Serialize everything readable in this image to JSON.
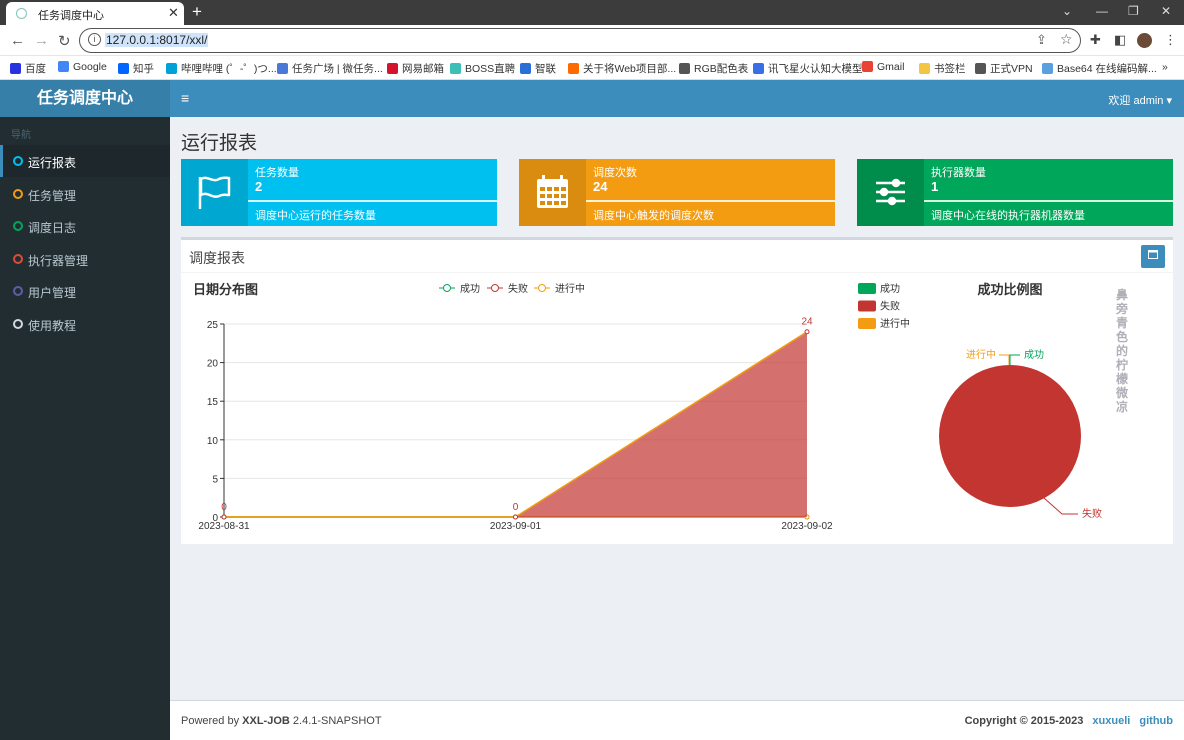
{
  "browser": {
    "tab_title": "任务调度中心",
    "tab_close": "✕",
    "new_tab": "+",
    "url": "127.0.0.1:8017/xxl/",
    "bookmarks": [
      {
        "label": "百度",
        "color": "#2932e1"
      },
      {
        "label": "Google",
        "color": "#4285f4"
      },
      {
        "label": "知乎",
        "color": "#0066ff"
      },
      {
        "label": "哔哩哔哩 (゜-゜)つ...",
        "color": "#00a1d6"
      },
      {
        "label": "任务广场 | 微任务...",
        "color": "#4a78d6"
      },
      {
        "label": "网易邮箱",
        "color": "#d4142a"
      },
      {
        "label": "BOSS直聘",
        "color": "#3bbfb6"
      },
      {
        "label": "智联",
        "color": "#2a6fd6"
      },
      {
        "label": "关于将Web项目部...",
        "color": "#ff6a00"
      },
      {
        "label": "RGB配色表",
        "color": "#555555"
      },
      {
        "label": "讯飞星火认知大模型",
        "color": "#3a6ee8"
      },
      {
        "label": "Gmail",
        "color": "#ea4335"
      },
      {
        "label": "书签栏",
        "color": "#f4c542"
      },
      {
        "label": "正式VPN",
        "color": "#555555"
      },
      {
        "label": "Base64 在线编码解...",
        "color": "#5aa0e0"
      }
    ],
    "more_bookmarks": "»"
  },
  "app": {
    "logo": "任务调度中心",
    "menu_toggle": "≡",
    "welcome": "欢迎 admin ▾"
  },
  "sidebar": {
    "header": "导航",
    "items": [
      {
        "label": "运行报表",
        "color": "#00c0ef",
        "active": true
      },
      {
        "label": "任务管理",
        "color": "#f39c12",
        "active": false
      },
      {
        "label": "调度日志",
        "color": "#00a65a",
        "active": false
      },
      {
        "label": "执行器管理",
        "color": "#dd4b39",
        "active": false
      },
      {
        "label": "用户管理",
        "color": "#605ca8",
        "active": false
      },
      {
        "label": "使用教程",
        "color": "#d2d6de",
        "active": false
      }
    ]
  },
  "main": {
    "title": "运行报表",
    "info_boxes": [
      {
        "title": "任务数量",
        "number": "2",
        "desc": "调度中心运行的任务数量",
        "icon": "flag-icon",
        "color": "#00c0ef",
        "icon_bg": "#00a7d0"
      },
      {
        "title": "调度次数",
        "number": "24",
        "desc": "调度中心触发的调度次数",
        "icon": "calendar-icon",
        "color": "#f39c12",
        "icon_bg": "#da8c10"
      },
      {
        "title": "执行器数量",
        "number": "1",
        "desc": "调度中心在线的执行器机器数量",
        "icon": "sliders-icon",
        "color": "#00a65a",
        "icon_bg": "#008d4c"
      }
    ],
    "report_title": "调度报表",
    "watermark": "鼻旁青色的柠檬微凉"
  },
  "colors": {
    "success": "#00a65a",
    "fail": "#c23531",
    "running": "#f39c12"
  },
  "chart_data": [
    {
      "type": "area",
      "title": "日期分布图",
      "x": [
        "2023-08-31",
        "2023-09-01",
        "2023-09-02"
      ],
      "series": [
        {
          "name": "成功",
          "values": [
            0,
            0,
            0
          ],
          "color": "#00a65a"
        },
        {
          "name": "失败",
          "values": [
            0,
            0,
            24
          ],
          "color": "#c23531"
        },
        {
          "name": "进行中",
          "values": [
            0,
            0,
            0
          ],
          "color": "#f39c12"
        }
      ],
      "data_labels": [
        "0",
        "0",
        "24"
      ],
      "ylim": [
        0,
        25
      ],
      "yticks": [
        0,
        5,
        10,
        15,
        20,
        25
      ],
      "legend": "top-center",
      "grid": true
    },
    {
      "type": "pie",
      "title": "成功比例图",
      "labels": [
        "成功",
        "失败",
        "进行中"
      ],
      "values": [
        0,
        24,
        0
      ],
      "colors": [
        "#00a65a",
        "#c23531",
        "#f39c12"
      ],
      "legend": "top-left"
    }
  ],
  "footer": {
    "powered_prefix": "Powered by ",
    "product": "XXL-JOB",
    "version": " 2.4.1-SNAPSHOT",
    "copyright": "Copyright © 2015-2023",
    "link1": "xuxueli",
    "link2": "github"
  }
}
